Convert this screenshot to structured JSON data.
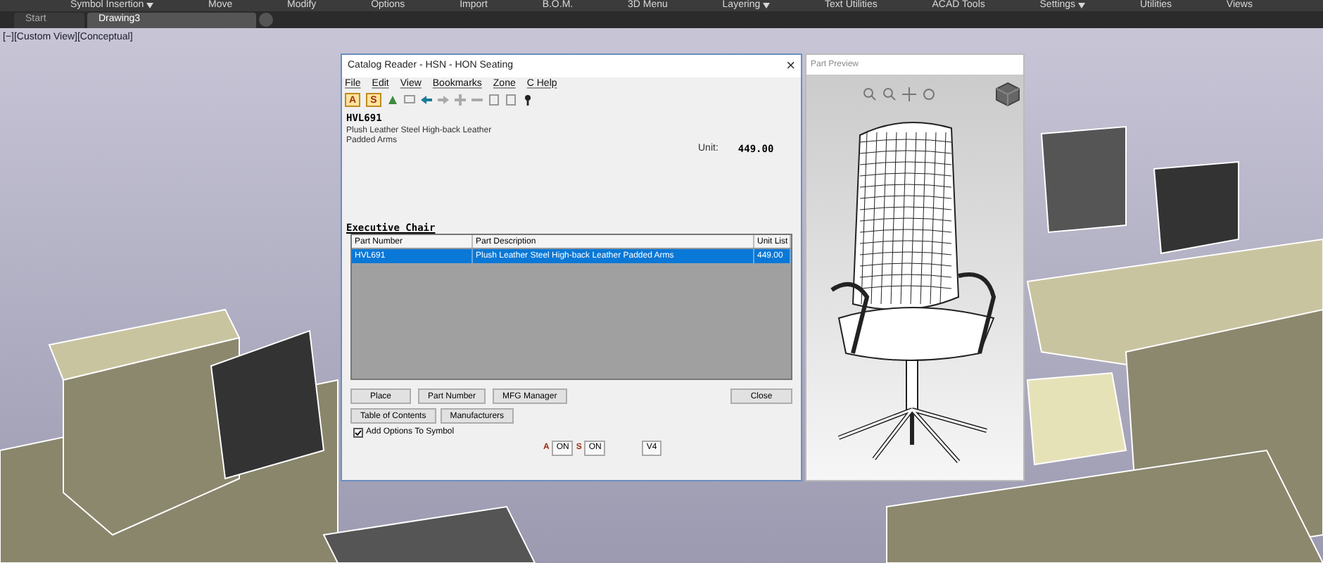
{
  "ribbon": {
    "panels": [
      {
        "label": "Symbol Insertion",
        "dropdown": true
      },
      {
        "label": "Move",
        "dropdown": false
      },
      {
        "label": "Modify",
        "dropdown": false
      },
      {
        "label": "Options",
        "dropdown": false
      },
      {
        "label": "Import",
        "dropdown": false
      },
      {
        "label": "B.O.M.",
        "dropdown": false
      },
      {
        "label": "3D Menu",
        "dropdown": false
      },
      {
        "label": "Layering",
        "dropdown": true
      },
      {
        "label": "Text Utilities",
        "dropdown": false
      },
      {
        "label": "ACAD Tools",
        "dropdown": false
      },
      {
        "label": "Settings",
        "dropdown": true
      },
      {
        "label": "Utilities",
        "dropdown": false
      },
      {
        "label": "Views",
        "dropdown": false
      }
    ]
  },
  "file_tabs": [
    {
      "label": "Start",
      "selected": false
    },
    {
      "label": "Drawing3",
      "selected": true
    }
  ],
  "viewport": {
    "label": "[−][Custom View][Conceptual]"
  },
  "dialog": {
    "title": "Catalog Reader - HSN - HON Seating",
    "close": "×",
    "menu": [
      "File",
      "Edit",
      "View",
      "Bookmarks",
      "Zone",
      "C Help"
    ],
    "toolbar_toggles": [
      {
        "label": "A",
        "on": true
      },
      {
        "label": "S",
        "on": true
      }
    ],
    "part_code": "HVL691",
    "part_description": "Plush Leather Steel High-back Leather Padded Arms",
    "unit_label": "Unit:",
    "unit_price": "449.00",
    "group_title": "Executive Chair",
    "table": {
      "columns": [
        "Part Number",
        "Part Description",
        "Unit List"
      ],
      "rows": [
        {
          "cells": [
            "HVL691",
            "Plush Leather Steel High-back Leather Padded Arms",
            "449.00"
          ],
          "selected": true
        }
      ]
    },
    "buttons_row1": [
      "Place",
      "Part Number",
      "MFG Manager"
    ],
    "close_button": "Close",
    "buttons_row2": [
      "Table of Contents",
      "Manufacturers"
    ],
    "add_options": {
      "label": "Add Options To Symbol",
      "checked": true
    },
    "status": [
      {
        "label": "A",
        "value": "ON"
      },
      {
        "label": "S",
        "value": "ON"
      }
    ],
    "version": "V4"
  },
  "preview": {
    "title": "Part Preview"
  }
}
